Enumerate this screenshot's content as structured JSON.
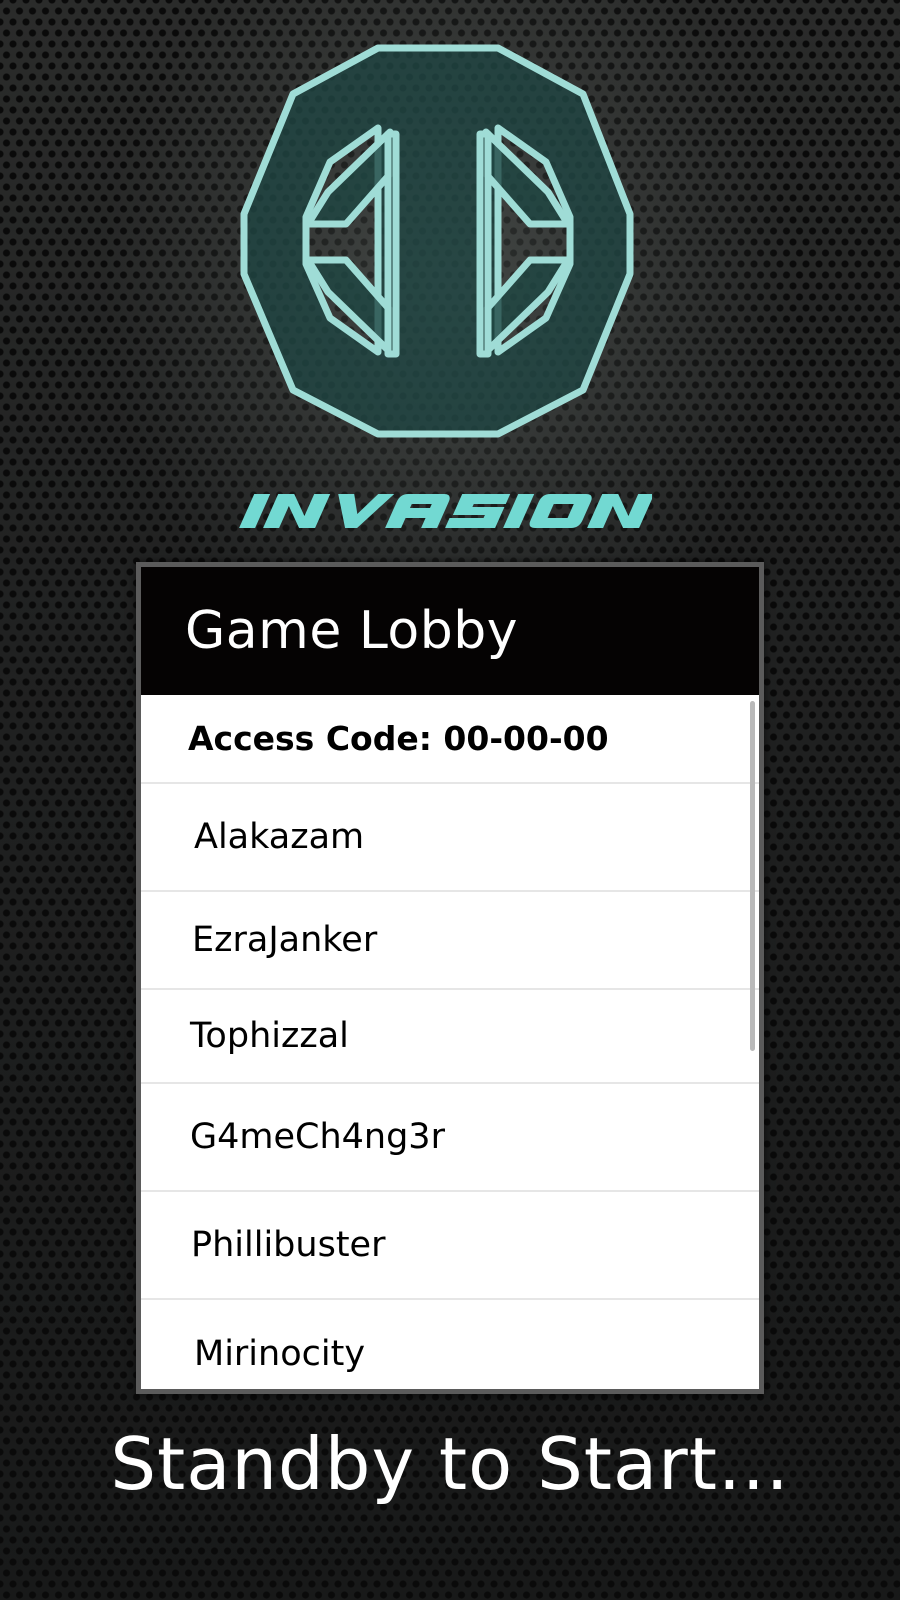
{
  "app": {
    "logo_text": "INVASION"
  },
  "colors": {
    "logo_stroke": "#9fdcd6",
    "logo_fill": "#1f4744",
    "wordmark": "#72d9d2",
    "header_bg": "#050303",
    "list_bg": "#ffffff",
    "frame": "#5b5b5b"
  },
  "lobby": {
    "title": "Game Lobby",
    "access_code_label": "Access Code: 00-00-00",
    "players": [
      "Alakazam",
      "EzraJanker",
      "Tophizzal",
      "G4meCh4ng3r",
      "Phillibuster",
      "Mirinocity"
    ]
  },
  "status": {
    "message": "Standby to Start..."
  }
}
